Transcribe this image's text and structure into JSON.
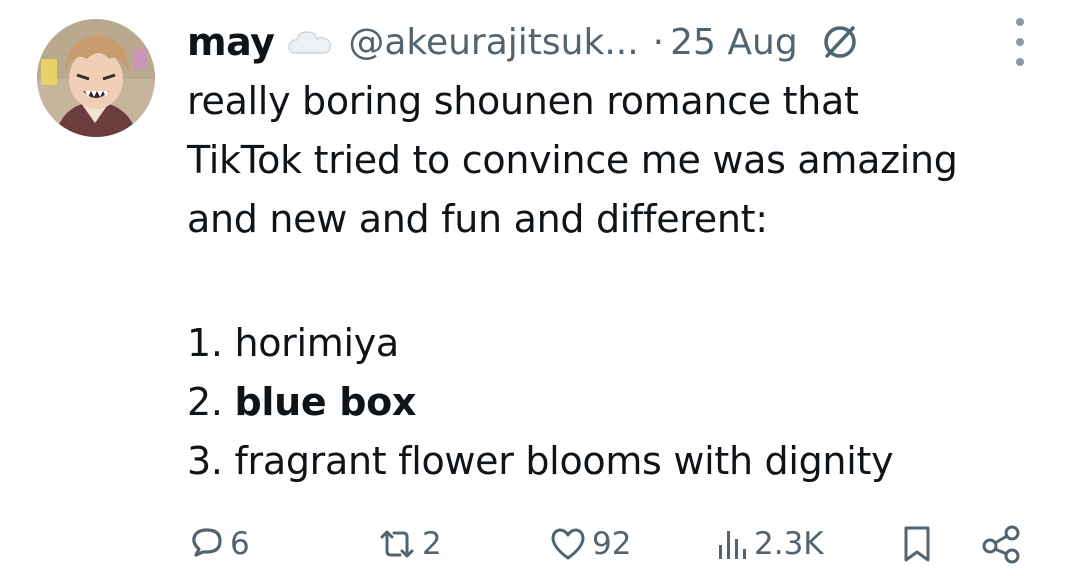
{
  "tweet": {
    "author_name": "may",
    "handle": "@akeurajitsuk...",
    "separator": "·",
    "date": "25 Aug",
    "body_lines": [
      "really boring shounen romance that",
      "TikTok tried to convince me was amazing",
      "and new and fun and different:"
    ],
    "list": [
      {
        "prefix": "1. ",
        "text": "horimiya",
        "bold": false
      },
      {
        "prefix": "2. ",
        "text": "blue box",
        "bold": true
      },
      {
        "prefix": "3. ",
        "text": "fragrant flower blooms with dignity",
        "bold": false
      }
    ]
  },
  "metrics": {
    "replies": "6",
    "reposts": "2",
    "likes": "92",
    "views": "2.3K"
  },
  "icons": {
    "cloud": "cloud-icon",
    "audit": "no-entry-circle-icon",
    "more": "more-vertical-icon",
    "reply": "reply-icon",
    "repost": "repost-icon",
    "like": "heart-icon",
    "views": "views-bar-chart-icon",
    "bookmark": "bookmark-icon",
    "share": "share-icon"
  },
  "colors": {
    "text": "#0f1419",
    "secondary": "#536471"
  }
}
